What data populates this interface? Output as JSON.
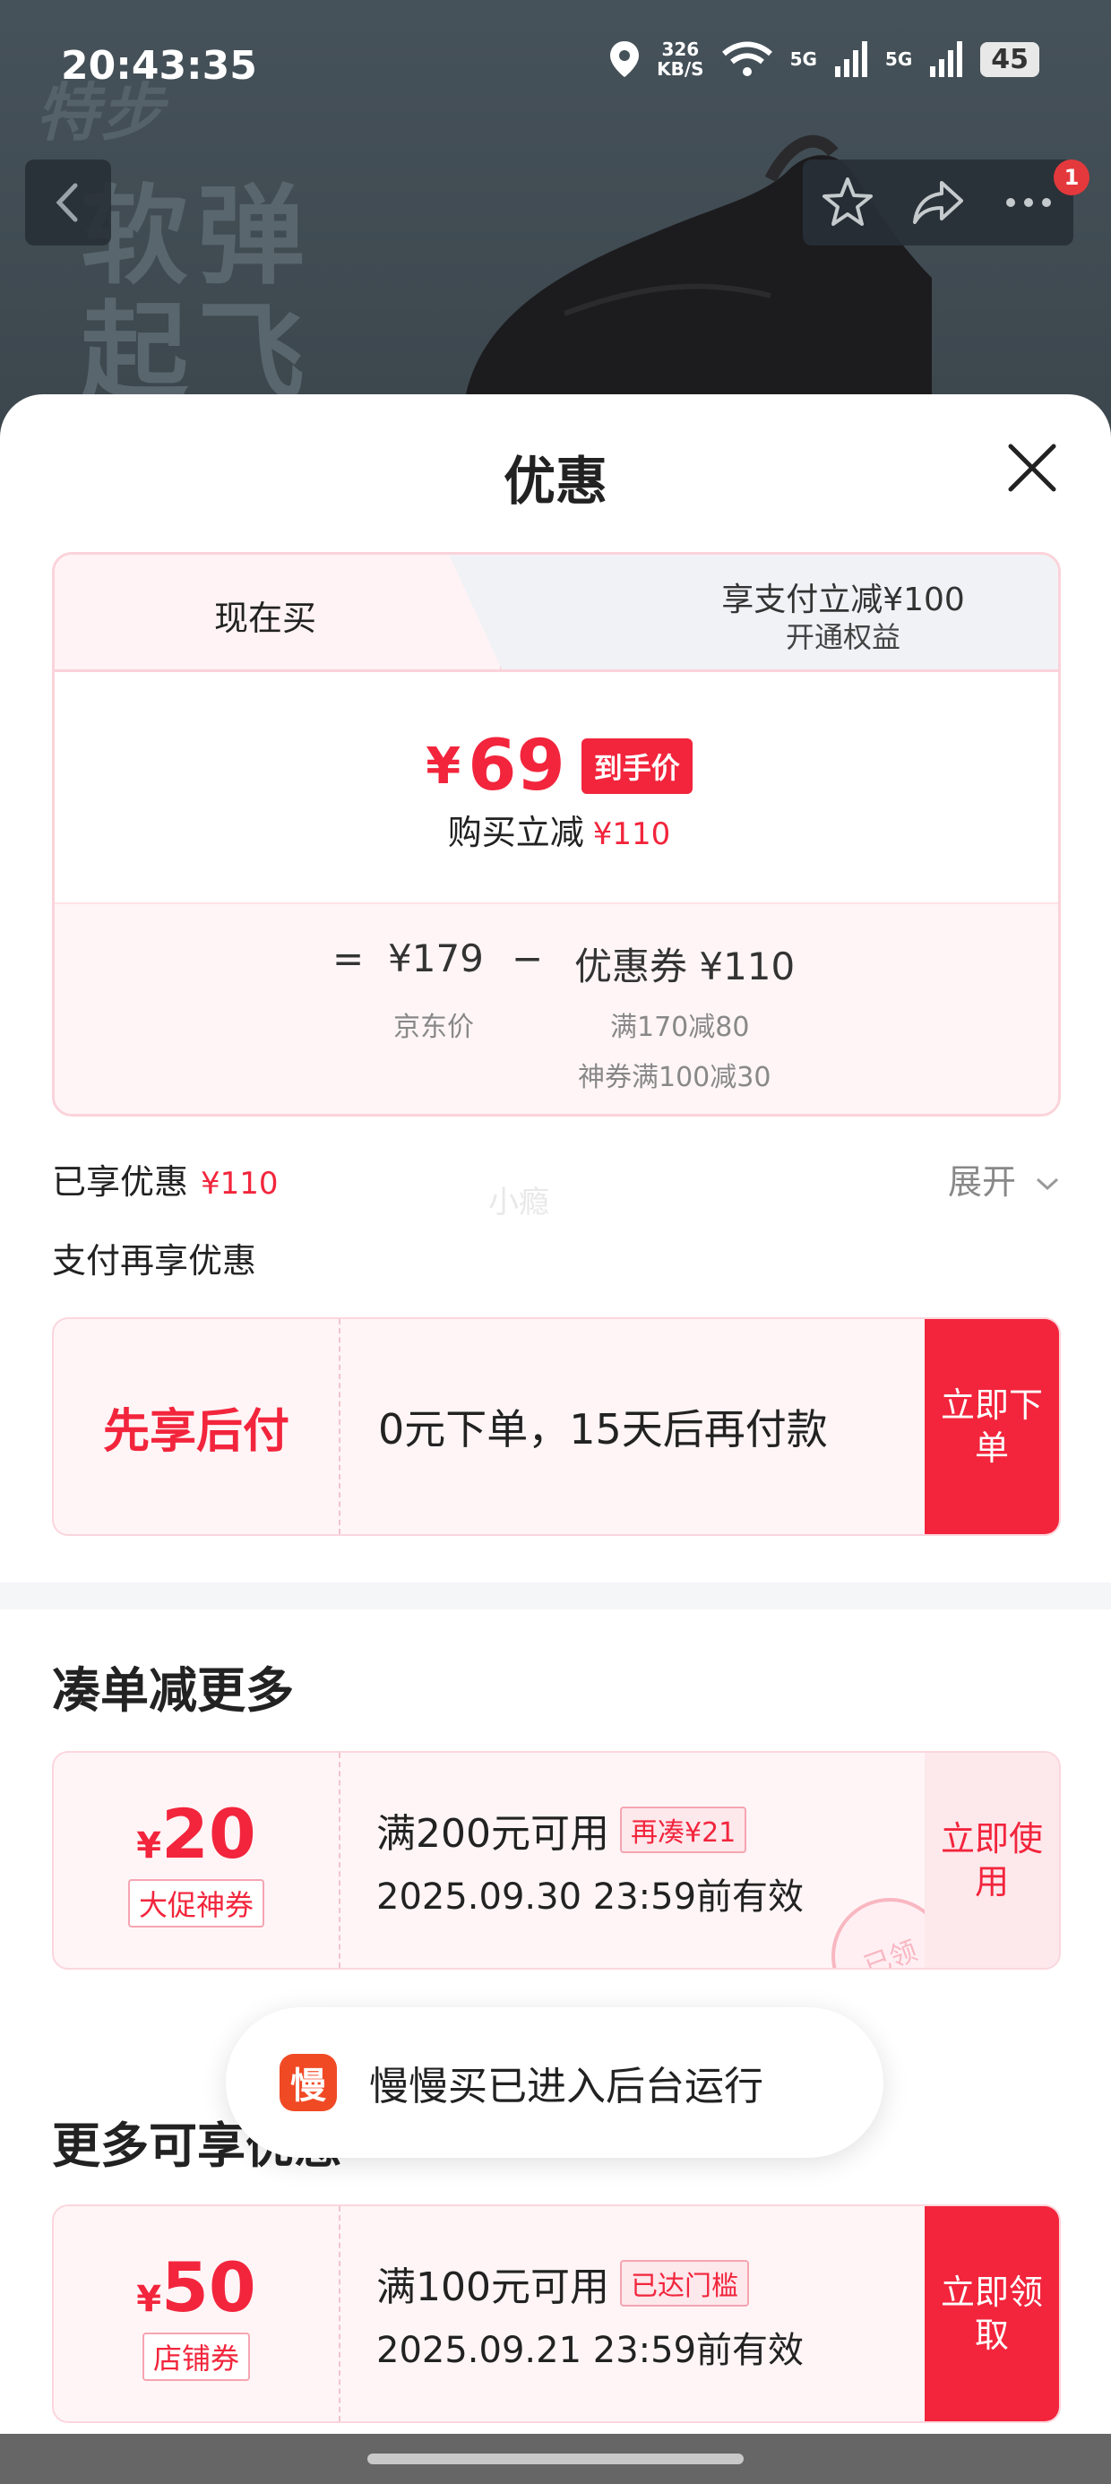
{
  "status": {
    "time": "20:43:35",
    "speed_value": "326",
    "speed_unit": "KB/S",
    "net1": "5G",
    "net2": "5G",
    "battery": "45"
  },
  "hero": {
    "brand": "特步",
    "slogan_line1": "软弹",
    "slogan_line2": "起飞"
  },
  "nav": {
    "badge_count": "1"
  },
  "sheet": {
    "title": "优惠"
  },
  "tabs": {
    "now": "现在买",
    "pay_title": "享支付立减¥100",
    "pay_sub": "开通权益"
  },
  "price": {
    "yen": "¥",
    "final": "69",
    "tag": "到手价",
    "cut_label": "购买立减",
    "cut_value": "¥110"
  },
  "breakdown": {
    "equals": "=",
    "jd_price": "¥179",
    "minus": "−",
    "coupon_label": "优惠券 ¥110",
    "jd_label": "京东价",
    "coupon_detail1": "满170减80",
    "coupon_detail2": "神券满100减30"
  },
  "applied": {
    "label": "已享优惠",
    "value": "¥110",
    "expand": "展开",
    "watermark": "小瘾"
  },
  "pay_section": {
    "label": "支付再享优惠",
    "bnpl_title": "先享后付",
    "bnpl_desc": "0元下单，15天后再付款",
    "action": "立即下单"
  },
  "bundle": {
    "title": "凑单减更多",
    "coupon": {
      "yen": "¥",
      "amount": "20",
      "tag": "大促神券",
      "condition": "满200元可用",
      "pill": "再凑¥21",
      "expiry": "2025.09.30 23:59前有效",
      "action": "立即使用",
      "stamp": "已领"
    }
  },
  "more": {
    "title": "更多可享优惠",
    "coupon": {
      "yen": "¥",
      "amount": "50",
      "tag": "店铺券",
      "condition": "满100元可用",
      "pill": "已达门槛",
      "expiry": "2025.09.21 23:59前有效",
      "action": "立即领取"
    }
  },
  "toast": {
    "icon": "慢",
    "text": "慢慢买已进入后台运行"
  },
  "colors": {
    "accent": "#f2253c",
    "pink_bg": "#fff5f7",
    "toast_icon": "#f04a24"
  }
}
